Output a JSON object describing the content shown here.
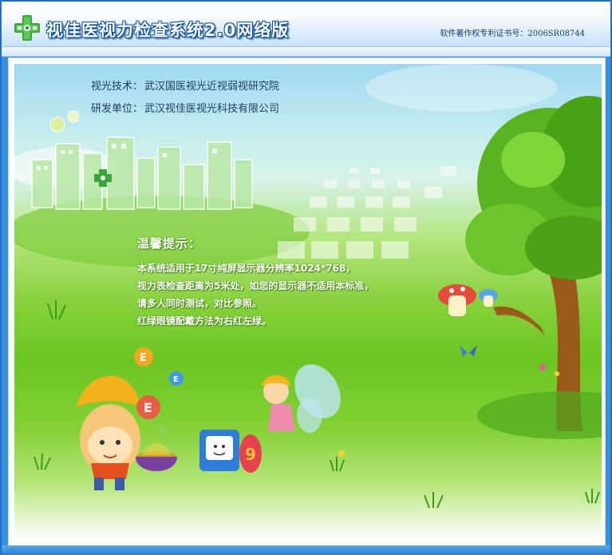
{
  "window": {
    "title": "视佳医视力检查系统2.0网络版",
    "copyright": "软件著作权专利证书号：2006SR08744"
  },
  "info": {
    "tech_label": "视光技术：",
    "tech_value": "武汉国医视光近视弱视研究院",
    "dev_label": "研发单位：",
    "dev_value": "武汉视佳医视光科技有限公司"
  },
  "tips": {
    "title": "温馨提示：",
    "lines": [
      "本系统适用于17寸纯屏显示器分辨率1024*768，",
      "视力表检查距离为5米处，如您的显示器不适用本标准，",
      "请多人同时测试，对比参照。",
      "红绿眼镜配戴方法为右红左绿。"
    ]
  },
  "icons": {
    "logo": "green-cross-eye-logo",
    "chart": "e-chart-icon"
  },
  "colors": {
    "title_text": "#ffffff",
    "title_outline": "#0b4f9a",
    "accent_blue": "#2a7fd0",
    "grass_green": "#6cc524",
    "info_text": "#1f3c66"
  }
}
